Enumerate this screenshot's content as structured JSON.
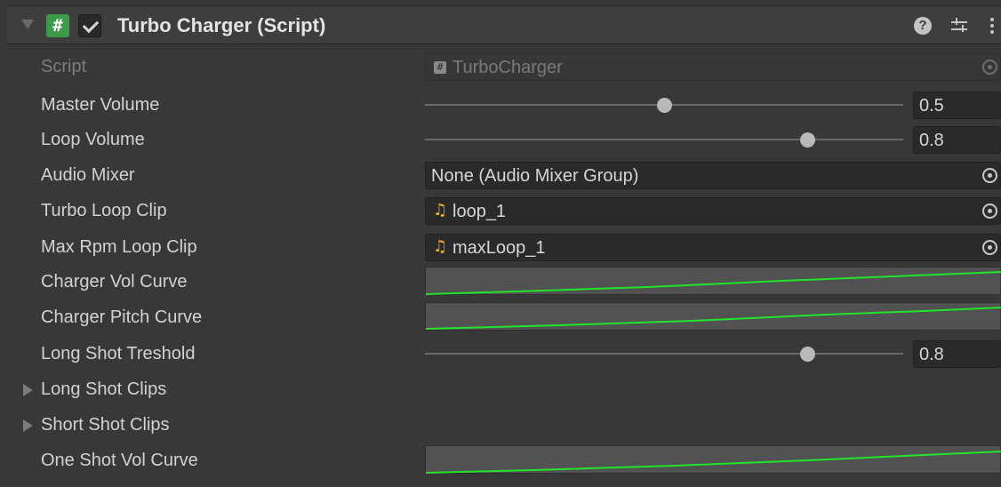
{
  "component": {
    "title": "Turbo Charger (Script)",
    "script_badge": "#",
    "help_glyph": "?",
    "icons": [
      "foldout-arrow",
      "script-icon",
      "checkbox",
      "help-icon",
      "preset-icon",
      "menu-icon"
    ]
  },
  "fields": {
    "script": {
      "label": "Script",
      "value": "TurboCharger",
      "icon": "script-icon"
    },
    "master_volume": {
      "label": "Master Volume",
      "value": "0.5",
      "fraction": 0.5
    },
    "loop_volume": {
      "label": "Loop Volume",
      "value": "0.8",
      "fraction": 0.8
    },
    "audio_mixer": {
      "label": "Audio Mixer",
      "value": "None (Audio Mixer Group)"
    },
    "turbo_loop_clip": {
      "label": "Turbo Loop Clip",
      "value": "loop_1",
      "icon": "audio-clip-icon"
    },
    "max_rpm_loop_clip": {
      "label": "Max Rpm Loop Clip",
      "value": "maxLoop_1",
      "icon": "audio-clip-icon"
    },
    "charger_vol_curve": {
      "label": "Charger Vol Curve"
    },
    "charger_pitch_curve": {
      "label": "Charger Pitch Curve"
    },
    "long_shot_treshold": {
      "label": "Long Shot Treshold",
      "value": "0.8",
      "fraction": 0.8
    },
    "long_shot_clips": {
      "label": "Long Shot Clips"
    },
    "short_shot_clips": {
      "label": "Short Shot Clips"
    },
    "one_shot_vol_curve": {
      "label": "One Shot Vol Curve"
    }
  },
  "colors": {
    "curve": "#22e52a",
    "background": "#383838",
    "header": "#3e3e3e",
    "field": "#2a2a2a"
  }
}
